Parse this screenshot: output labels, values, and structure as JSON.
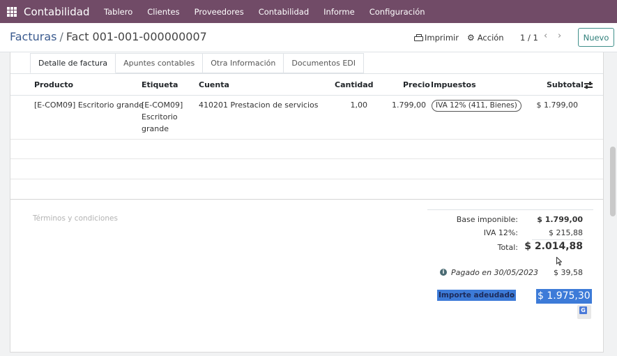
{
  "navbar": {
    "app_name": "Contabilidad",
    "menu": [
      "Tablero",
      "Clientes",
      "Proveedores",
      "Contabilidad",
      "Informe",
      "Configuración"
    ]
  },
  "breadcrumb": {
    "parent": "Facturas",
    "separator": "/",
    "current": "Fact 001-001-000000007"
  },
  "toolbar": {
    "print_label": "Imprimir",
    "action_label": "Acción",
    "pager": "1 / 1",
    "new_label": "Nuevo"
  },
  "tabs": [
    "Detalle de factura",
    "Apuntes contables",
    "Otra Información",
    "Documentos EDI"
  ],
  "table": {
    "headers": {
      "product": "Producto",
      "label": "Etiqueta",
      "account": "Cuenta",
      "quantity": "Cantidad",
      "price": "Precio",
      "taxes": "Impuestos",
      "subtotal": "Subtotal"
    },
    "rows": [
      {
        "product": "[E-COM09] Escritorio grande",
        "label_line1": "[E-COM09]",
        "label_line2": "Escritorio",
        "label_line3": "grande",
        "account": "410201 Prestacion de servicios",
        "quantity": "1,00",
        "price": "1.799,00",
        "tax": "IVA 12% (411, Bienes)",
        "subtotal": "$ 1.799,00"
      }
    ]
  },
  "terms_placeholder": "Términos y condiciones",
  "totals": {
    "base_label": "Base imponible:",
    "base_value": "$ 1.799,00",
    "iva_label": "IVA 12%:",
    "iva_value": "$ 215,88",
    "total_label": "Total:",
    "total_value": "$ 2.014,88",
    "paid_label": "Pagado en 30/05/2023",
    "paid_value": "$ 39,58",
    "due_label": "Importe adeudado",
    "due_colon": ":",
    "due_value": "$ 1.975,30"
  },
  "colors": {
    "navbar": "#714b67",
    "link": "#3b5b8f",
    "primary_outline": "#3f8f8a",
    "selection": "#3d7bd8"
  },
  "icons": [
    "apps-grid-icon",
    "printer-icon",
    "gear-icon",
    "chevron-left-icon",
    "chevron-right-icon",
    "column-settings-icon",
    "info-icon",
    "mouse-cursor-icon",
    "translate-icon"
  ]
}
